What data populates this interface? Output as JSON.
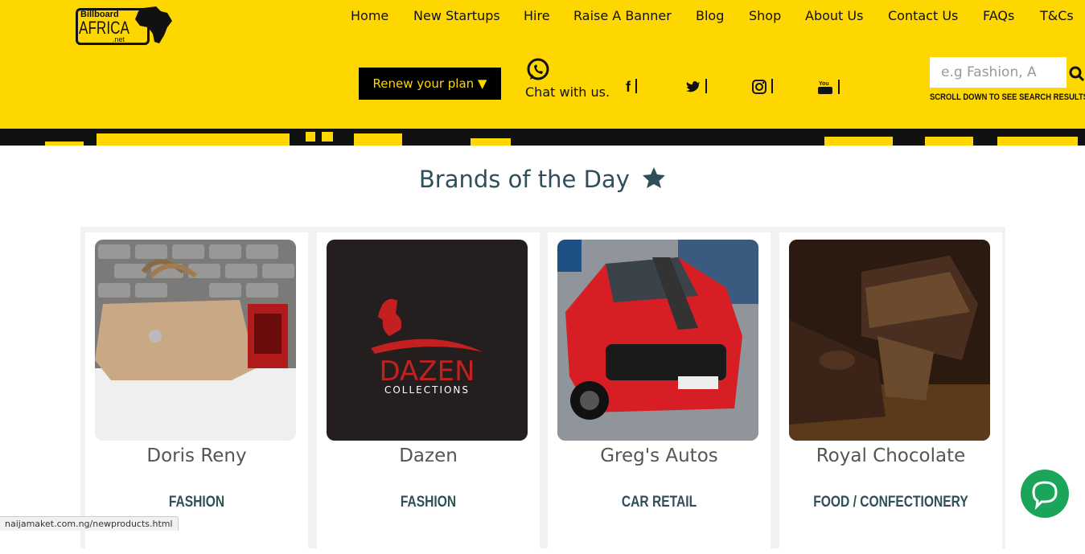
{
  "logo": {
    "line1": "Billboard",
    "line2": "AFRICA",
    "line3": ".net"
  },
  "nav": [
    {
      "label": "Home"
    },
    {
      "label": "New Startups"
    },
    {
      "label": "Hire"
    },
    {
      "label": "Raise A Banner"
    },
    {
      "label": "Blog"
    },
    {
      "label": "Shop"
    },
    {
      "label": "About Us"
    },
    {
      "label": "Contact Us"
    },
    {
      "label": "FAQs"
    },
    {
      "label": "T&Cs"
    }
  ],
  "header": {
    "renew_label": "Renew your plan ▼",
    "chat_label": "Chat with us.",
    "social": [
      "f",
      "t",
      "i",
      "yt"
    ],
    "search_placeholder": "e.g Fashion, A",
    "scroll_note": "SCROLL DOWN TO SEE SEARCH RESULTS."
  },
  "main": {
    "title": "Brands of the Day"
  },
  "brands": [
    {
      "name": "Doris Reny",
      "category": "FASHION"
    },
    {
      "name": "Dazen",
      "category": "FASHION",
      "logo_main": "DAZEN",
      "logo_sub": "COLLECTIONS"
    },
    {
      "name": "Greg's Autos",
      "category": "CAR RETAIL"
    },
    {
      "name": "Royal Chocolate",
      "category": "FOOD / CONFECTIONERY"
    }
  ],
  "status_bar": {
    "url": "naijamaket.com.ng/newproducts.html"
  },
  "colors": {
    "header_bg": "#ffd700",
    "title": "#2f4f5a",
    "chat_bubble": "#1ba55a"
  }
}
